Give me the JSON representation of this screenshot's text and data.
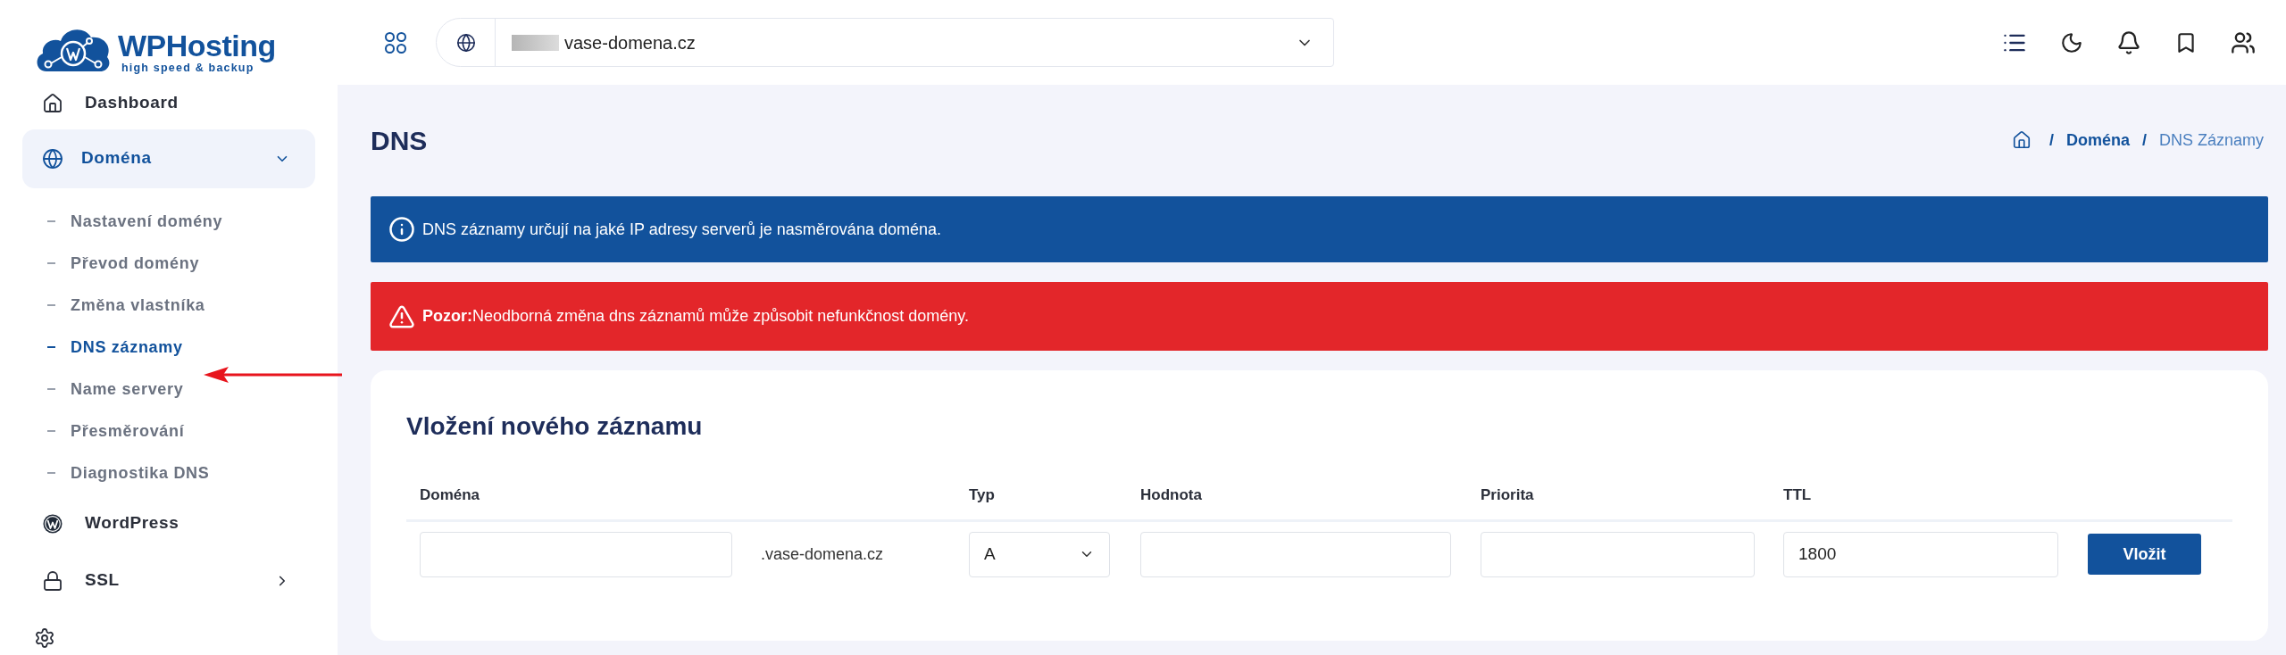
{
  "logo": {
    "name": "WPHosting",
    "tagline": "high speed & backup"
  },
  "sidebar": {
    "items": [
      {
        "kind": "link",
        "label": "Dashboard",
        "selected": false
      },
      {
        "kind": "group",
        "label": "Doména",
        "selected": true,
        "expanded": true,
        "children": [
          {
            "label": "Nastavení domény",
            "selected": false
          },
          {
            "label": "Převod domény",
            "selected": false
          },
          {
            "label": "Změna vlastníka",
            "selected": false
          },
          {
            "label": "DNS záznamy",
            "selected": true
          },
          {
            "label": "Name servery",
            "selected": false
          },
          {
            "label": "Přesměrování",
            "selected": false
          },
          {
            "label": "Diagnostika DNS",
            "selected": false
          }
        ]
      },
      {
        "kind": "link",
        "label": "WordPress",
        "selected": false
      },
      {
        "kind": "group",
        "label": "SSL",
        "selected": false,
        "expanded": false
      }
    ]
  },
  "header": {
    "domain_select": {
      "value": "vase-domena.cz"
    }
  },
  "page": {
    "title": "DNS",
    "breadcrumb": {
      "separator": "/",
      "items": [
        {
          "label": "Doména",
          "current": false
        },
        {
          "label": "DNS Záznamy",
          "current": true
        }
      ]
    }
  },
  "alerts": [
    {
      "kind": "info",
      "text": "DNS záznamy určují na jaké IP adresy serverů je nasměrována doména."
    },
    {
      "kind": "danger",
      "text": "**Pozor:**Neodborná změna dns záznamů může způsobit nefunkčnost domény."
    }
  ],
  "card": {
    "title": "Vložení nového záznamu",
    "columns": [
      "Doména",
      "Typ",
      "Hodnota",
      "Priorita",
      "TTL"
    ],
    "form": {
      "domain_suffix": ".vase-domena.cz",
      "type": {
        "value": "A"
      },
      "ttl": {
        "value": "1800"
      },
      "submit": "Vložit"
    }
  }
}
